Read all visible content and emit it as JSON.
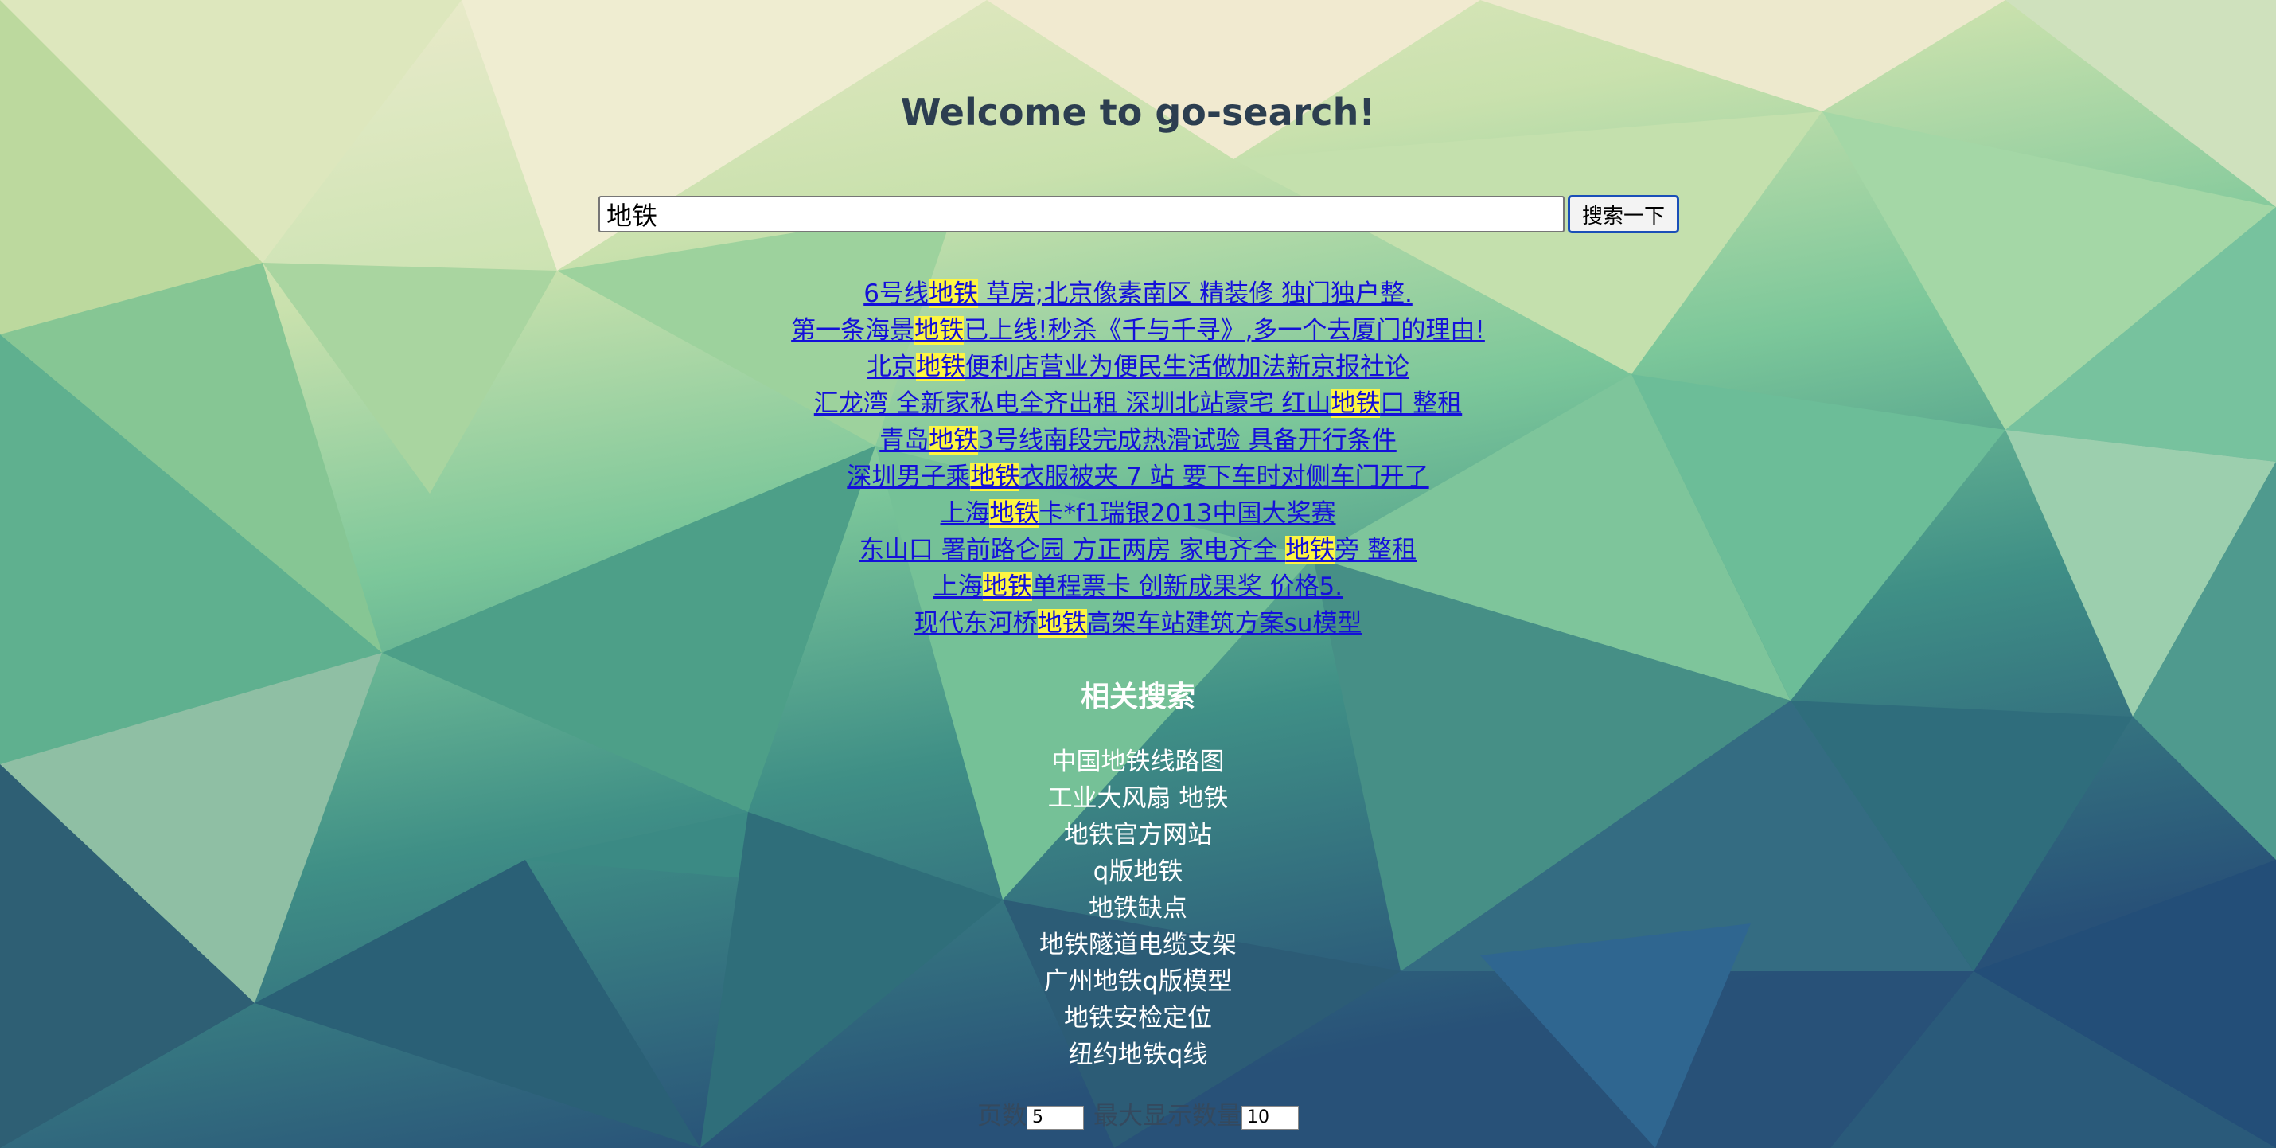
{
  "page": {
    "title": "Welcome to go-search!"
  },
  "search": {
    "value": "地铁",
    "button_label": "搜索一下",
    "highlight_color": "#fdf542",
    "link_color": "#1410d9"
  },
  "results": [
    {
      "pre": "6号线",
      "hit": "地铁",
      "post": " 草房;北京像素南区 精装修 独门独户整."
    },
    {
      "pre": "第一条海景",
      "hit": "地铁",
      "post": "已上线!秒杀《千与千寻》,多一个去厦门的理由!"
    },
    {
      "pre": "北京",
      "hit": "地铁",
      "post": "便利店营业为便民生活做加法新京报社论"
    },
    {
      "pre": "汇龙湾 全新家私电全齐出租 深圳北站豪宅 红山",
      "hit": "地铁",
      "post": "口 整租"
    },
    {
      "pre": "青岛",
      "hit": "地铁",
      "post": "3号线南段完成热滑试验 具备开行条件"
    },
    {
      "pre": "深圳男子乘",
      "hit": "地铁",
      "post": "衣服被夹 7 站 要下车时对侧车门开了"
    },
    {
      "pre": "上海",
      "hit": "地铁",
      "post": "卡*f1瑞银2013中国大奖赛"
    },
    {
      "pre": "东山口 署前路仑园 方正两房 家电齐全 ",
      "hit": "地铁",
      "post": "旁 整租"
    },
    {
      "pre": "上海",
      "hit": "地铁",
      "post": "单程票卡 创新成果奖  价格5."
    },
    {
      "pre": "现代东河桥",
      "hit": "地铁",
      "post": "高架车站建筑方案su模型"
    }
  ],
  "related": {
    "title": "相关搜索",
    "items": [
      "中国地铁线路图",
      "工业大风扇 地铁",
      "地铁官方网站",
      "q版地铁",
      "地铁缺点",
      "地铁隧道电缆支架",
      "广州地铁q版模型",
      "地铁安检定位",
      "纽约地铁q线"
    ]
  },
  "pager": {
    "pages_label": "页数",
    "pages_value": "5",
    "max_label": "最大显示数量",
    "max_value": "10"
  },
  "background": {
    "palette": [
      "#eeebc8",
      "#d9e6b5",
      "#9fd3a4",
      "#6dbb96",
      "#3e8f87",
      "#2f6f7e",
      "#2b4f7a"
    ]
  }
}
